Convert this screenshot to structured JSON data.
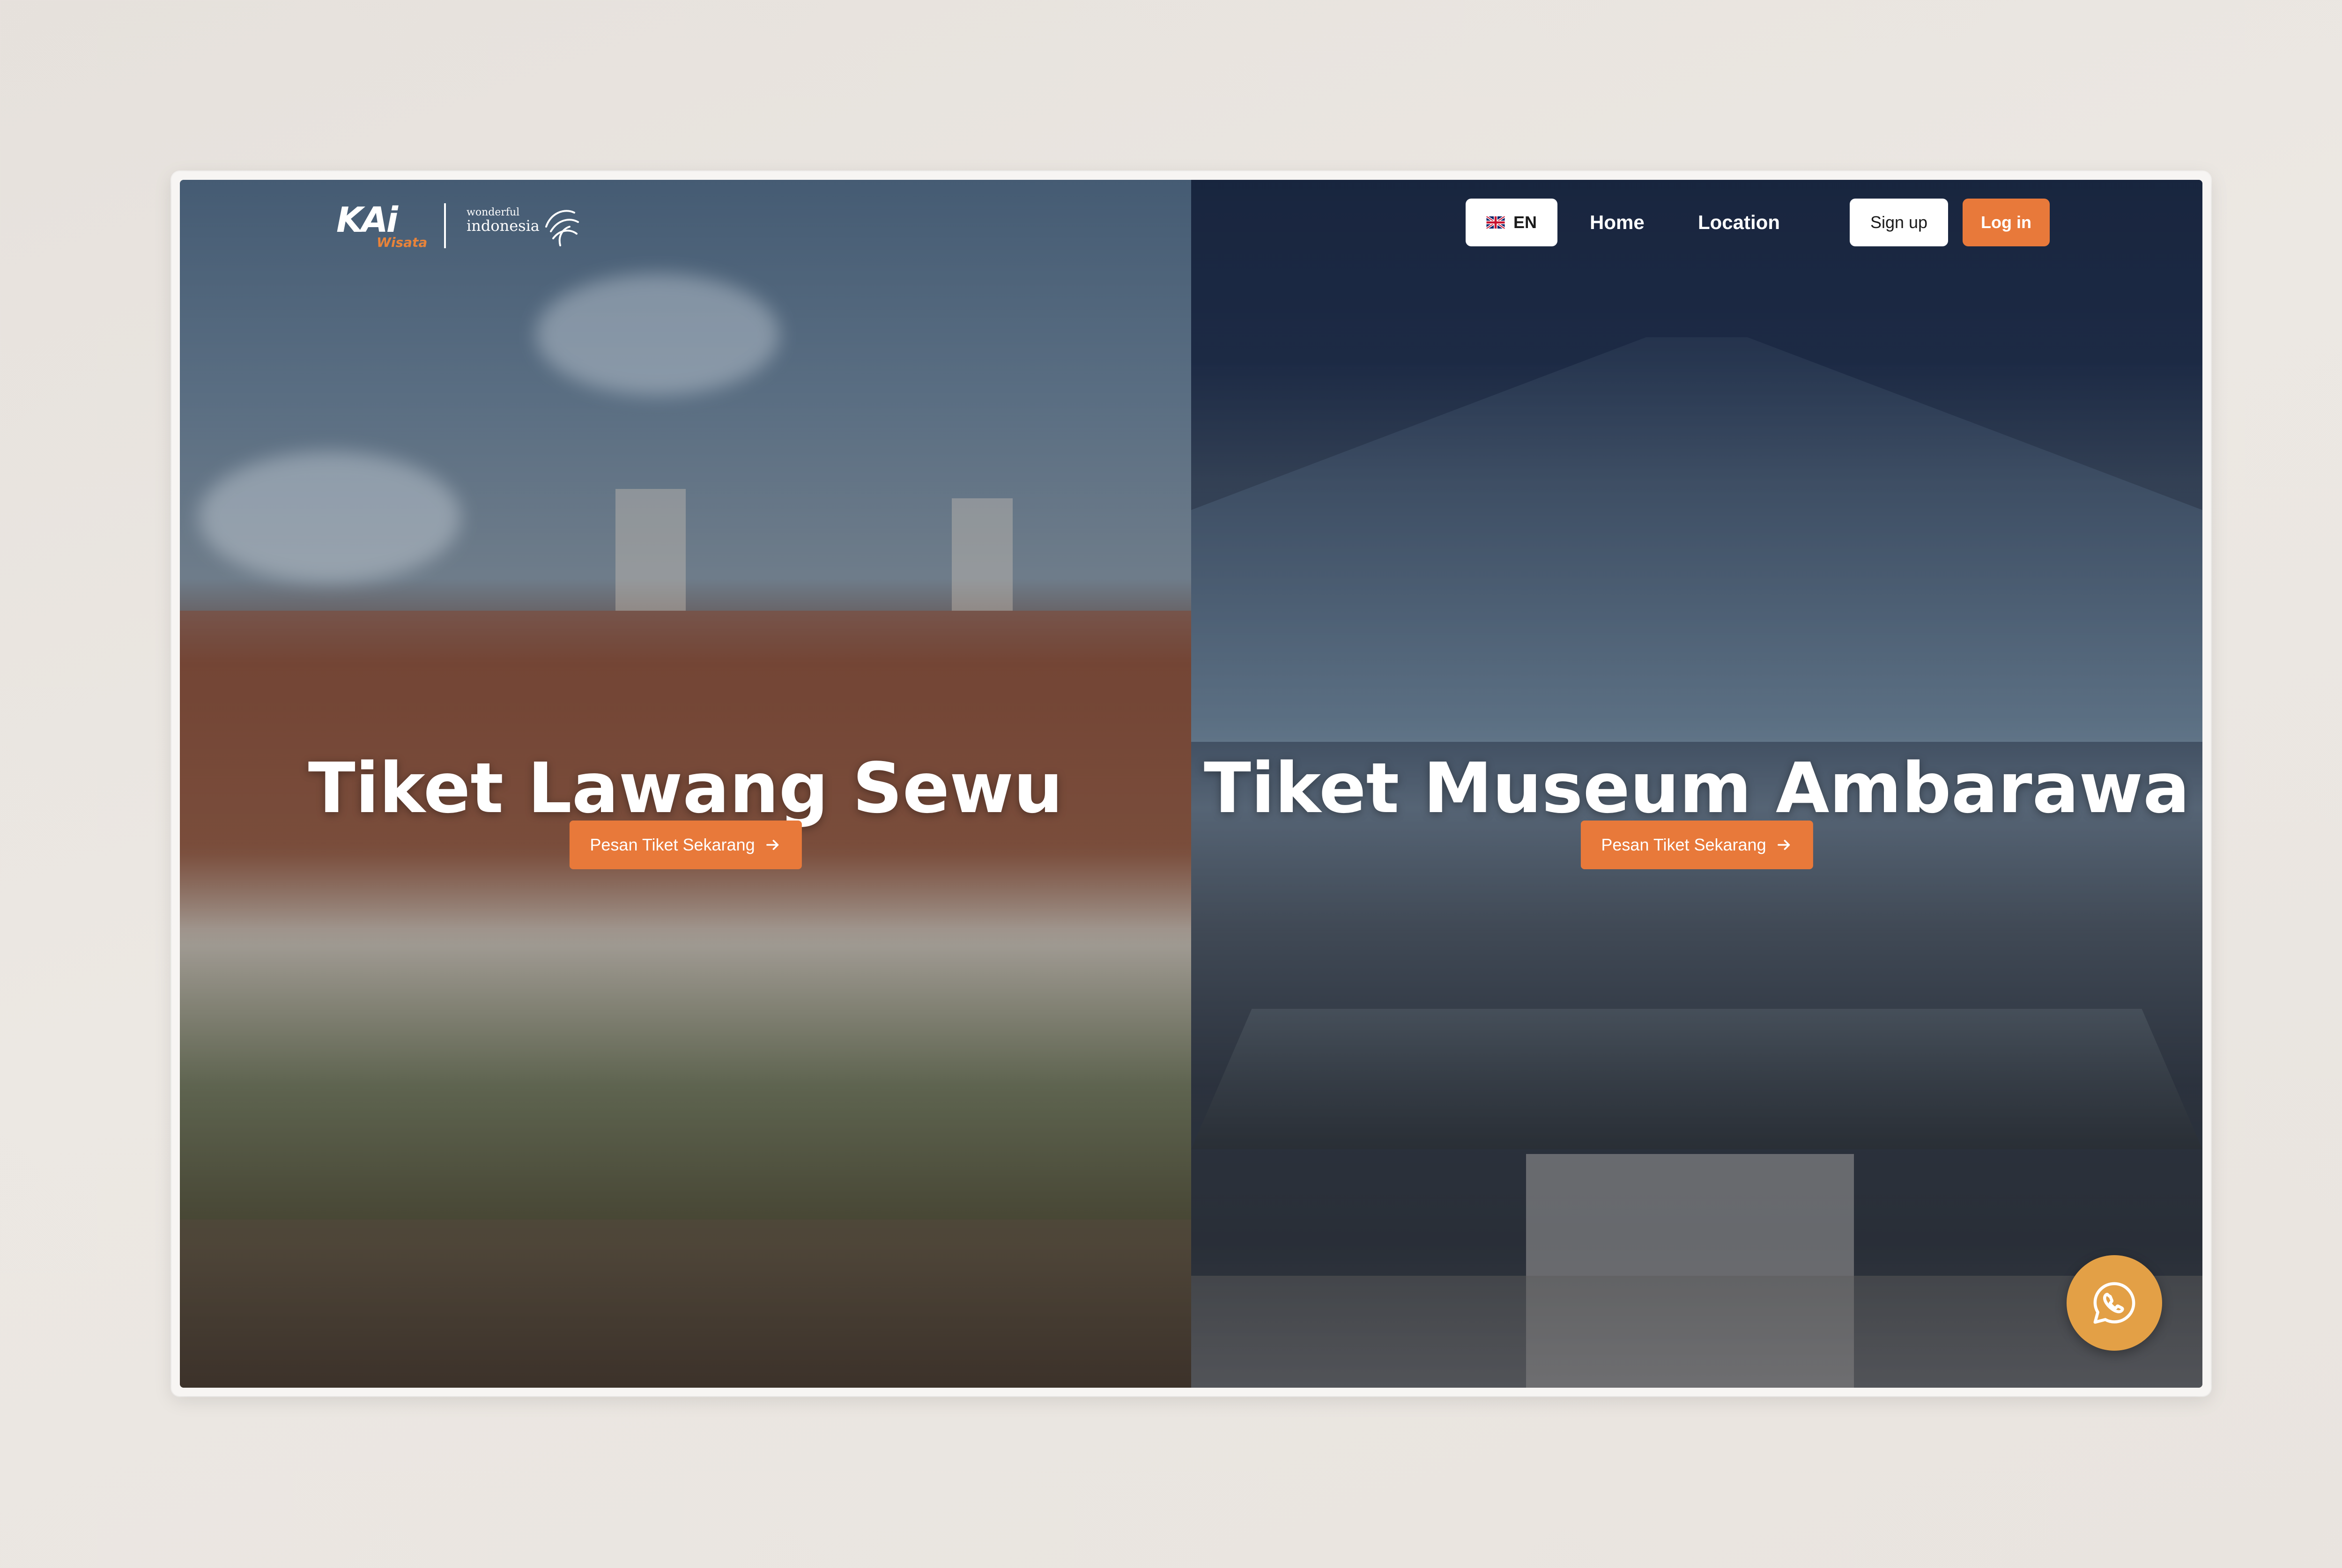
{
  "header": {
    "logo": {
      "brand_text": "KAi",
      "sub_text": "Wisata",
      "partner_top": "wonderful",
      "partner_bottom": "indonesia"
    },
    "language": {
      "label": "EN",
      "flag_icon": "uk-flag-icon"
    },
    "nav": {
      "home": "Home",
      "location": "Location"
    },
    "auth": {
      "signup": "Sign up",
      "login": "Log in"
    }
  },
  "panels": [
    {
      "title": "Tiket Lawang Sewu",
      "cta": "Pesan Tiket Sekarang",
      "cta_icon": "arrow-right-icon"
    },
    {
      "title": "Tiket Museum Ambarawa",
      "cta": "Pesan Tiket Sekarang",
      "cta_icon": "arrow-right-icon"
    }
  ],
  "floating": {
    "whatsapp_icon": "whatsapp-icon"
  },
  "colors": {
    "accent": "#e8793a",
    "whatsapp": "#e3a046",
    "page_bg": "#e9e4df",
    "text_on_dark": "#ffffff"
  }
}
